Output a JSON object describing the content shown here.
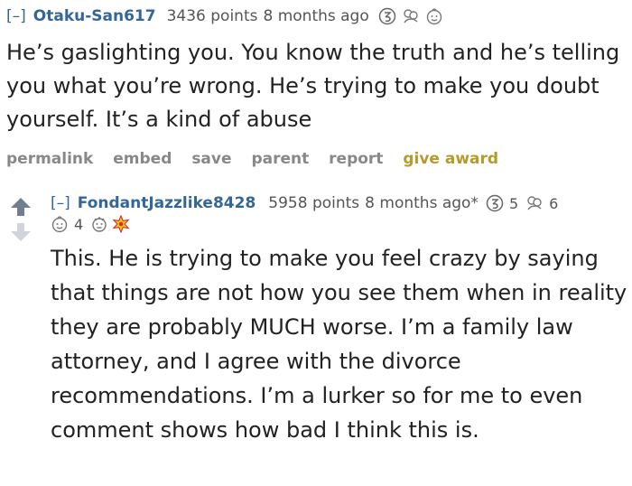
{
  "parent": {
    "collapse": "[–]",
    "author": "Otaku-San617",
    "score": "3436 points",
    "time": "8 months ago",
    "body": "He’s gaslighting you. You know the truth and he’s telling you what you’re wrong. He’s trying to make you doubt yourself. It’s a kind of abuse",
    "awards": [
      {
        "icon": "silver-award-icon"
      },
      {
        "icon": "hug-award-icon"
      },
      {
        "icon": "wholesome-award-icon"
      }
    ]
  },
  "buttons": {
    "permalink": "permalink",
    "embed": "embed",
    "save": "save",
    "parent": "parent",
    "report": "report",
    "give_award": "give award"
  },
  "reply": {
    "collapse": "[–]",
    "author": "FondantJazzlike8428",
    "score": "5958 points",
    "time": "8 months ago*",
    "silver_count": "5",
    "hug_count": "6",
    "wholesome_count": "4",
    "body": "This. He is trying to make you feel crazy by saying that things are not how you see them when in reality they are probably MUCH worse. I’m a family law attorney, and I agree with the divorce recommendations. I’m a lurker so for me to even comment shows how bad I think this is."
  },
  "colors": {
    "link": "#336699",
    "muted": "#888888",
    "award": "#b69a2a",
    "text": "#222222"
  }
}
